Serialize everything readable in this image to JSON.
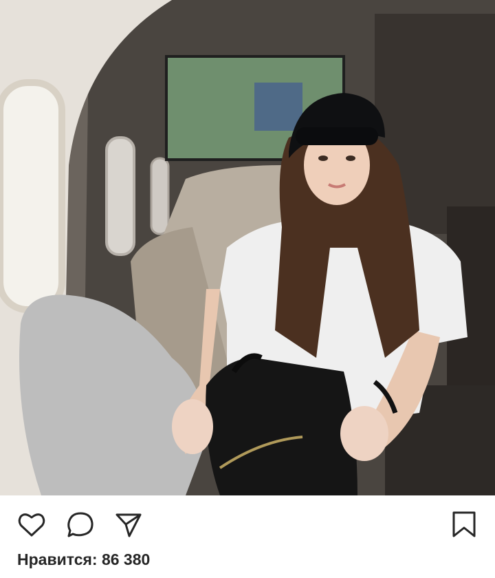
{
  "post": {
    "photo_icon": "photo",
    "actions": [
      "heart-icon",
      "comment-icon",
      "share-icon",
      "bookmark-icon"
    ],
    "likes_text": "Нравится: 86 380"
  }
}
